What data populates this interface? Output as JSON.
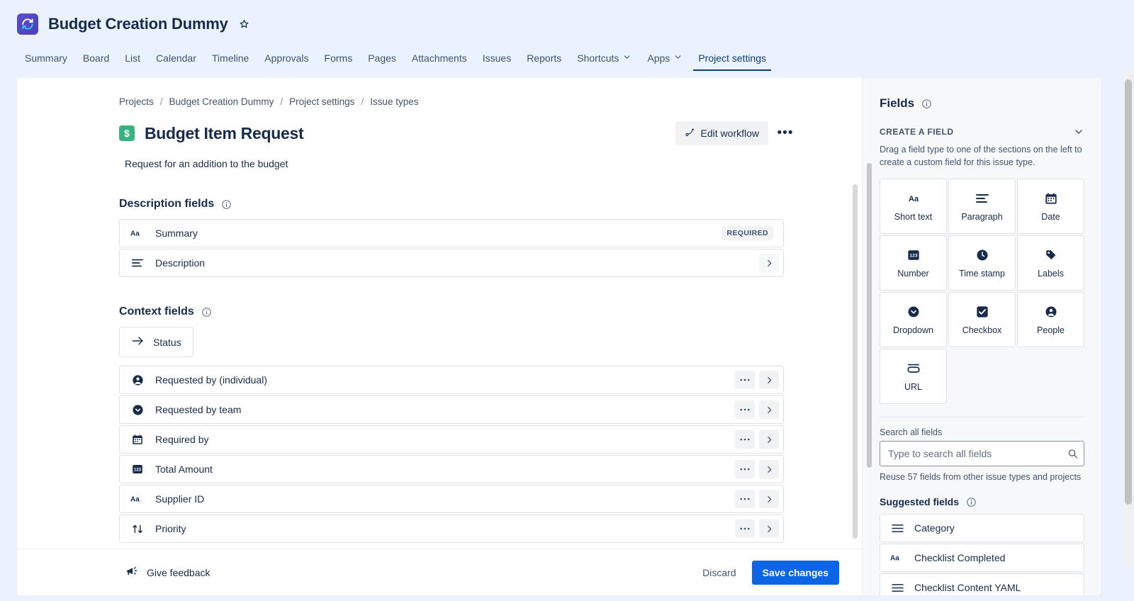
{
  "topbar": {
    "project_name": "Budget Creation Dummy",
    "project_icon": "sync-arrows-icon",
    "star_icon": "star-outline-icon",
    "tabs": [
      {
        "label": "Summary",
        "active": false,
        "has_caret": false
      },
      {
        "label": "Board",
        "active": false,
        "has_caret": false
      },
      {
        "label": "List",
        "active": false,
        "has_caret": false
      },
      {
        "label": "Calendar",
        "active": false,
        "has_caret": false
      },
      {
        "label": "Timeline",
        "active": false,
        "has_caret": false
      },
      {
        "label": "Approvals",
        "active": false,
        "has_caret": false
      },
      {
        "label": "Forms",
        "active": false,
        "has_caret": false
      },
      {
        "label": "Pages",
        "active": false,
        "has_caret": false
      },
      {
        "label": "Attachments",
        "active": false,
        "has_caret": false
      },
      {
        "label": "Issues",
        "active": false,
        "has_caret": false
      },
      {
        "label": "Reports",
        "active": false,
        "has_caret": false
      },
      {
        "label": "Shortcuts",
        "active": false,
        "has_caret": true
      },
      {
        "label": "Apps",
        "active": false,
        "has_caret": true
      },
      {
        "label": "Project settings",
        "active": true,
        "has_caret": false
      }
    ]
  },
  "main": {
    "breadcrumb": [
      "Projects",
      "Budget Creation Dummy",
      "Project settings",
      "Issue types"
    ],
    "breadcrumb_separator": "/",
    "issue_type_icon": "dollar-sign-icon",
    "issue_type_title": "Budget Item Request",
    "issue_type_description": "Request for an addition to the budget",
    "edit_workflow_label": "Edit workflow",
    "edit_workflow_icon": "workflow-icon",
    "more_actions_icon": "more-horizontal-icon",
    "description_section": {
      "title": "Description fields",
      "info_icon": "info-circle-icon",
      "fields": [
        {
          "label": "Summary",
          "icon": "short-text-icon",
          "badge": "REQUIRED",
          "has_more": false,
          "has_chevron": false
        },
        {
          "label": "Description",
          "icon": "paragraph-icon",
          "badge": "",
          "has_more": false,
          "has_chevron": true
        }
      ]
    },
    "context_section": {
      "title": "Context fields",
      "info_icon": "info-circle-icon",
      "status_button": {
        "label": "Status",
        "icon": "arrow-right-icon"
      },
      "fields": [
        {
          "label": "Requested by (individual)",
          "icon": "people-icon",
          "has_more": true,
          "has_chevron": true
        },
        {
          "label": "Requested by team",
          "icon": "dropdown-icon",
          "has_more": true,
          "has_chevron": true
        },
        {
          "label": "Required by",
          "icon": "date-icon",
          "has_more": true,
          "has_chevron": true
        },
        {
          "label": "Total Amount",
          "icon": "number-icon",
          "has_more": true,
          "has_chevron": true
        },
        {
          "label": "Supplier ID",
          "icon": "short-text-icon",
          "has_more": true,
          "has_chevron": true
        },
        {
          "label": "Priority",
          "icon": "priority-icon",
          "has_more": true,
          "has_chevron": true
        }
      ]
    }
  },
  "footer": {
    "feedback_label": "Give feedback",
    "feedback_icon": "megaphone-icon",
    "discard_label": "Discard",
    "save_label": "Save changes",
    "save_color": "#0C66E4"
  },
  "sidebar": {
    "title": "Fields",
    "title_info_icon": "info-circle-icon",
    "create_section_label": "CREATE A FIELD",
    "collapse_icon": "chevron-down-icon",
    "create_description": "Drag a field type to one of the sections on the left to create a custom field for this issue type.",
    "field_types": [
      {
        "label": "Short text",
        "icon": "short-text-icon"
      },
      {
        "label": "Paragraph",
        "icon": "paragraph-icon"
      },
      {
        "label": "Date",
        "icon": "date-icon"
      },
      {
        "label": "Number",
        "icon": "number-icon"
      },
      {
        "label": "Time stamp",
        "icon": "clock-icon"
      },
      {
        "label": "Labels",
        "icon": "tag-icon"
      },
      {
        "label": "Dropdown",
        "icon": "dropdown-icon"
      },
      {
        "label": "Checkbox",
        "icon": "checkbox-icon"
      },
      {
        "label": "People",
        "icon": "people-icon"
      },
      {
        "label": "URL",
        "icon": "url-icon"
      }
    ],
    "search_label": "Search all fields",
    "search_placeholder": "Type to search all fields",
    "search_value": "",
    "search_icon": "search-icon",
    "reuse_text": "Reuse 57 fields from other issue types and projects",
    "suggested_title": "Suggested fields",
    "suggested_info_icon": "info-circle-icon",
    "suggested_fields": [
      {
        "label": "Category",
        "icon": "paragraph-icon"
      },
      {
        "label": "Checklist Completed",
        "icon": "short-text-icon"
      },
      {
        "label": "Checklist Content YAML",
        "icon": "paragraph-icon"
      }
    ]
  }
}
